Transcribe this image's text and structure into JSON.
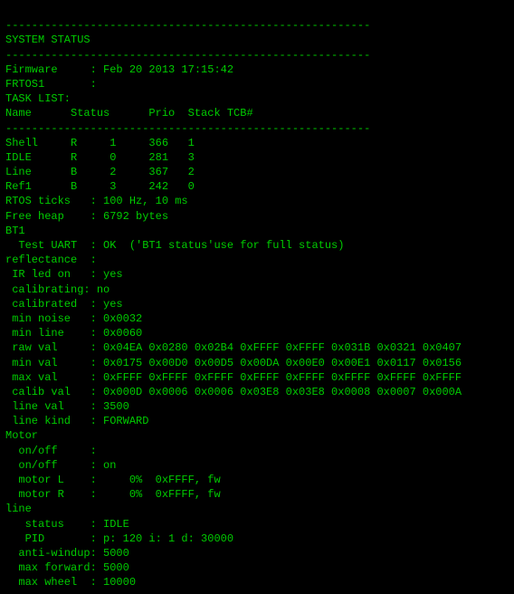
{
  "terminal": {
    "lines": [
      "--------------------------------------------------------",
      "SYSTEM STATUS",
      "--------------------------------------------------------",
      "Firmware     : Feb 20 2013 17:15:42",
      "FRTOS1       :",
      "TASK LIST:",
      "Name      Status      Prio  Stack TCB#",
      "--------------------------------------------------------",
      "Shell     R     1     366   1",
      "IDLE      R     0     281   3",
      "Line      B     2     367   2",
      "Ref1      B     3     242   0",
      "",
      "RTOS ticks   : 100 Hz, 10 ms",
      "Free heap    : 6792 bytes",
      "BT1",
      "  Test UART  : OK  ('BT1 status'use for full status)",
      "reflectance  :",
      " IR led on   : yes",
      " calibrating: no",
      " calibrated  : yes",
      " min noise   : 0x0032",
      " min line    : 0x0060",
      " raw val     : 0x04EA 0x0280 0x02B4 0xFFFF 0xFFFF 0x031B 0x0321 0x0407",
      " min val     : 0x0175 0x00D0 0x00D5 0x00DA 0x00E0 0x00E1 0x0117 0x0156",
      " max val     : 0xFFFF 0xFFFF 0xFFFF 0xFFFF 0xFFFF 0xFFFF 0xFFFF 0xFFFF",
      " calib val   : 0x000D 0x0006 0x0006 0x03E8 0x03E8 0x0008 0x0007 0x000A",
      " line val    : 3500",
      " line kind   : FORWARD",
      "Motor",
      "  on/off     :",
      "  on/off     : on",
      "  motor L    :     0%  0xFFFF, fw",
      "  motor R    :     0%  0xFFFF, fw",
      "line",
      "   status    : IDLE",
      "   PID       : p: 120 i: 1 d: 30000",
      "  anti-windup: 5000",
      "  max forward: 5000",
      "  max wheel  : 10000"
    ]
  }
}
